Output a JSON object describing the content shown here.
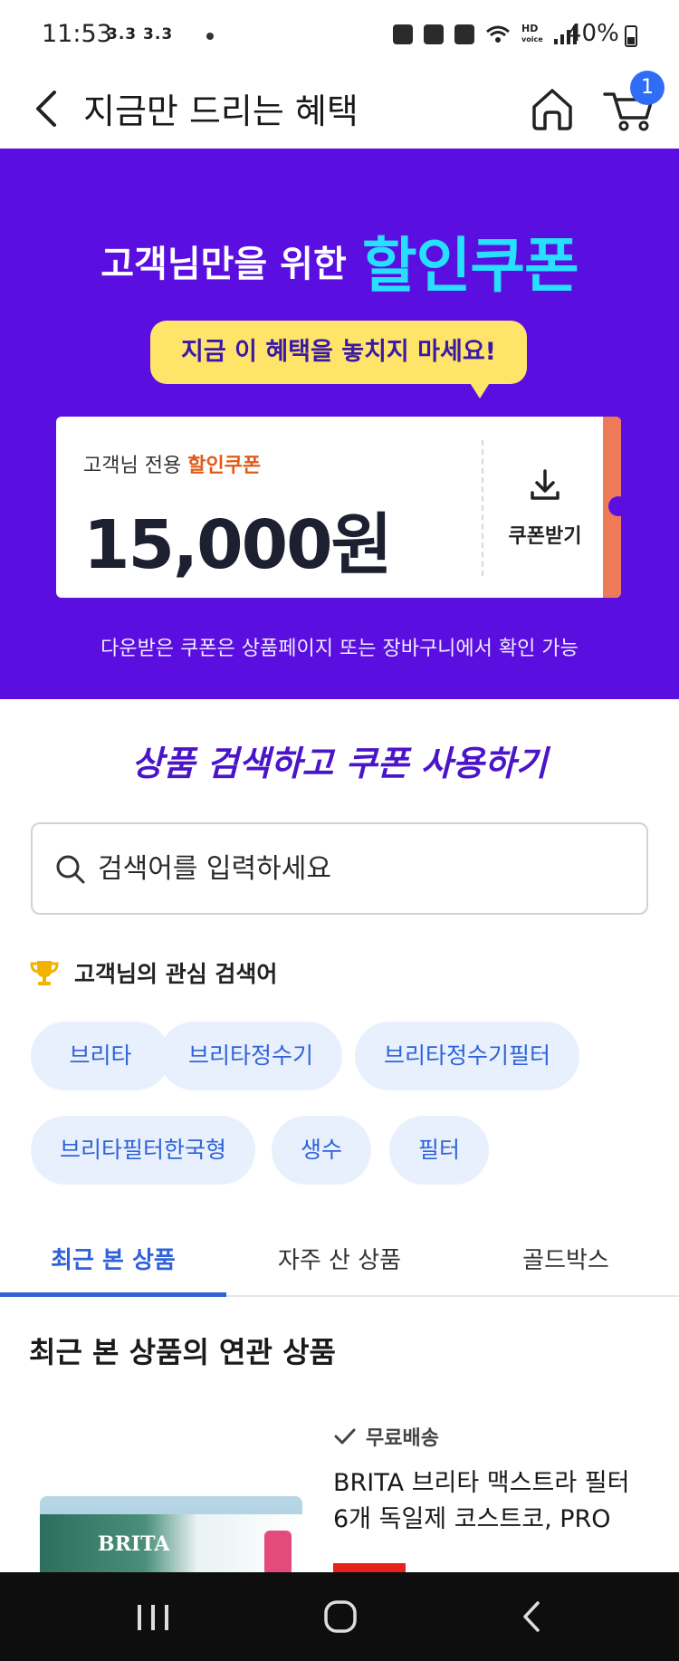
{
  "status_bar": {
    "time": "11:53",
    "left_indicators": "3.3 3.3",
    "hd_label": "HD",
    "hd_sublabel": "voice",
    "battery": "40%"
  },
  "header": {
    "title": "지금만 드리는 혜택",
    "cart_count": "1"
  },
  "hero": {
    "headline": "고객님만을 위한",
    "headline_accent": "할인쿠폰",
    "bubble": "지금 이 혜택을 놓치지 마세요!",
    "coupon": {
      "label": "고객님 전용",
      "label_accent": "할인쿠폰",
      "amount": "15,000원",
      "download_label": "쿠폰받기"
    },
    "note": "다운받은 쿠폰은 상품페이지 또는 장바구니에서 확인 가능"
  },
  "search_section": {
    "title": "상품 검색하고 쿠폰 사용하기",
    "placeholder": "검색어를 입력하세요"
  },
  "interests": {
    "title": "고객님의 관심 검색어",
    "chips": [
      "브리타",
      "브리타정수기",
      "브리타정수기필터",
      "브리타필터한국형",
      "생수",
      "필터"
    ]
  },
  "tabs": {
    "items": [
      "최근 본 상품",
      "자주 산 상품",
      "골드박스"
    ],
    "active_index": 0
  },
  "related": {
    "title": "최근 본 상품의 연관 상품",
    "product": {
      "shipping": "무료배송",
      "name": "BRITA 브리타 맥스트라 필터 6개 독일제 코스트코, PRO",
      "brand_text": "BRITA"
    }
  },
  "colors": {
    "hero_bg": "#5a0fe0",
    "accent_cyan": "#27e0ff",
    "bubble": "#ffe46a",
    "link_blue": "#2f62d8",
    "coupon_edge": "#ef7a5a"
  },
  "icons": {
    "back": "chevron-left-icon",
    "home": "home-icon",
    "cart": "cart-icon",
    "download": "download-icon",
    "search": "search-icon",
    "trophy": "trophy-icon",
    "check": "check-icon"
  }
}
